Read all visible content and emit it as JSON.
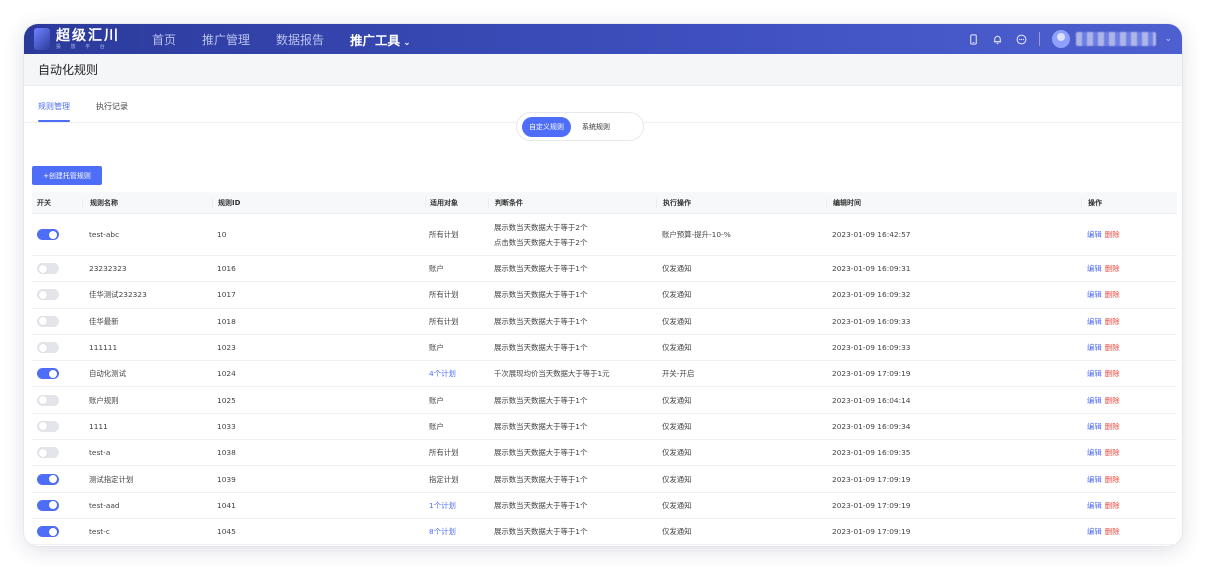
{
  "topbar": {
    "logo_title": "超级汇川",
    "logo_subtitle": "投 放 平 台",
    "nav": [
      {
        "label": "首页",
        "active": false
      },
      {
        "label": "推广管理",
        "active": false
      },
      {
        "label": "数据报告",
        "active": false
      },
      {
        "label": "推广工具",
        "active": true,
        "has_dropdown": true
      }
    ],
    "icons": [
      "mobile-icon",
      "bell-icon",
      "more-circle-icon"
    ]
  },
  "page": {
    "title": "自动化规则",
    "tabs": [
      {
        "label": "规则管理",
        "active": true
      },
      {
        "label": "执行记录",
        "active": false
      }
    ],
    "segments": [
      {
        "label": "自定义规则",
        "active": true
      },
      {
        "label": "系统规则",
        "active": false
      }
    ],
    "create_button": "+创建托管规则"
  },
  "table": {
    "headers": {
      "switch": "开关",
      "name": "规则名称",
      "id": "规则ID",
      "target": "适用对象",
      "condition": "判断条件",
      "action": "执行操作",
      "time": "编辑时间",
      "ops": "操作"
    },
    "ops": {
      "edit": "编辑",
      "delete": "删除"
    },
    "rows": [
      {
        "on": true,
        "name": "test-abc",
        "id": "10",
        "target": "所有计划",
        "target_link": false,
        "condition": "展示数当天数据大于等于2个",
        "condition2": "点击数当天数据大于等于2个",
        "action": "账户预算-提升-10-%",
        "time": "2023-01-09 16:42:57"
      },
      {
        "on": false,
        "name": "23232323",
        "id": "1016",
        "target": "账户",
        "target_link": false,
        "condition": "展示数当天数据大于等于1个",
        "action": "仅发通知",
        "time": "2023-01-09 16:09:31"
      },
      {
        "on": false,
        "name": "佳华测试232323",
        "id": "1017",
        "target": "所有计划",
        "target_link": false,
        "condition": "展示数当天数据大于等于1个",
        "action": "仅发通知",
        "time": "2023-01-09 16:09:32"
      },
      {
        "on": false,
        "name": "佳华最新",
        "id": "1018",
        "target": "所有计划",
        "target_link": false,
        "condition": "展示数当天数据大于等于1个",
        "action": "仅发通知",
        "time": "2023-01-09 16:09:33"
      },
      {
        "on": false,
        "name": "111111",
        "id": "1023",
        "target": "账户",
        "target_link": false,
        "condition": "展示数当天数据大于等于1个",
        "action": "仅发通知",
        "time": "2023-01-09 16:09:33"
      },
      {
        "on": true,
        "name": "自动化测试",
        "id": "1024",
        "target": "4个计划",
        "target_link": true,
        "condition": "千次展现均价当天数据大于等于1元",
        "action": "开关-开启",
        "time": "2023-01-09 17:09:19"
      },
      {
        "on": false,
        "name": "账户规则",
        "id": "1025",
        "target": "账户",
        "target_link": false,
        "condition": "展示数当天数据大于等于1个",
        "action": "仅发通知",
        "time": "2023-01-09 16:04:14"
      },
      {
        "on": false,
        "name": "1111",
        "id": "1033",
        "target": "账户",
        "target_link": false,
        "condition": "展示数当天数据大于等于1个",
        "action": "仅发通知",
        "time": "2023-01-09 16:09:34"
      },
      {
        "on": false,
        "name": "test-a",
        "id": "1038",
        "target": "所有计划",
        "target_link": false,
        "condition": "展示数当天数据大于等于1个",
        "action": "仅发通知",
        "time": "2023-01-09 16:09:35"
      },
      {
        "on": true,
        "name": "测试指定计划",
        "id": "1039",
        "target": "指定计划",
        "target_link": false,
        "condition": "展示数当天数据大于等于1个",
        "action": "仅发通知",
        "time": "2023-01-09 17:09:19"
      },
      {
        "on": true,
        "name": "test-aad",
        "id": "1041",
        "target": "1个计划",
        "target_link": true,
        "condition": "展示数当天数据大于等于1个",
        "action": "仅发通知",
        "time": "2023-01-09 17:09:19"
      },
      {
        "on": true,
        "name": "test-c",
        "id": "1045",
        "target": "8个计划",
        "target_link": true,
        "condition": "展示数当天数据大于等于1个",
        "action": "仅发通知",
        "time": "2023-01-09 17:09:19"
      }
    ]
  },
  "colors": {
    "primary": "#4f6ef7",
    "danger": "#f0453a",
    "topbar_start": "#2b3a9a",
    "topbar_end": "#4e5fd0"
  }
}
